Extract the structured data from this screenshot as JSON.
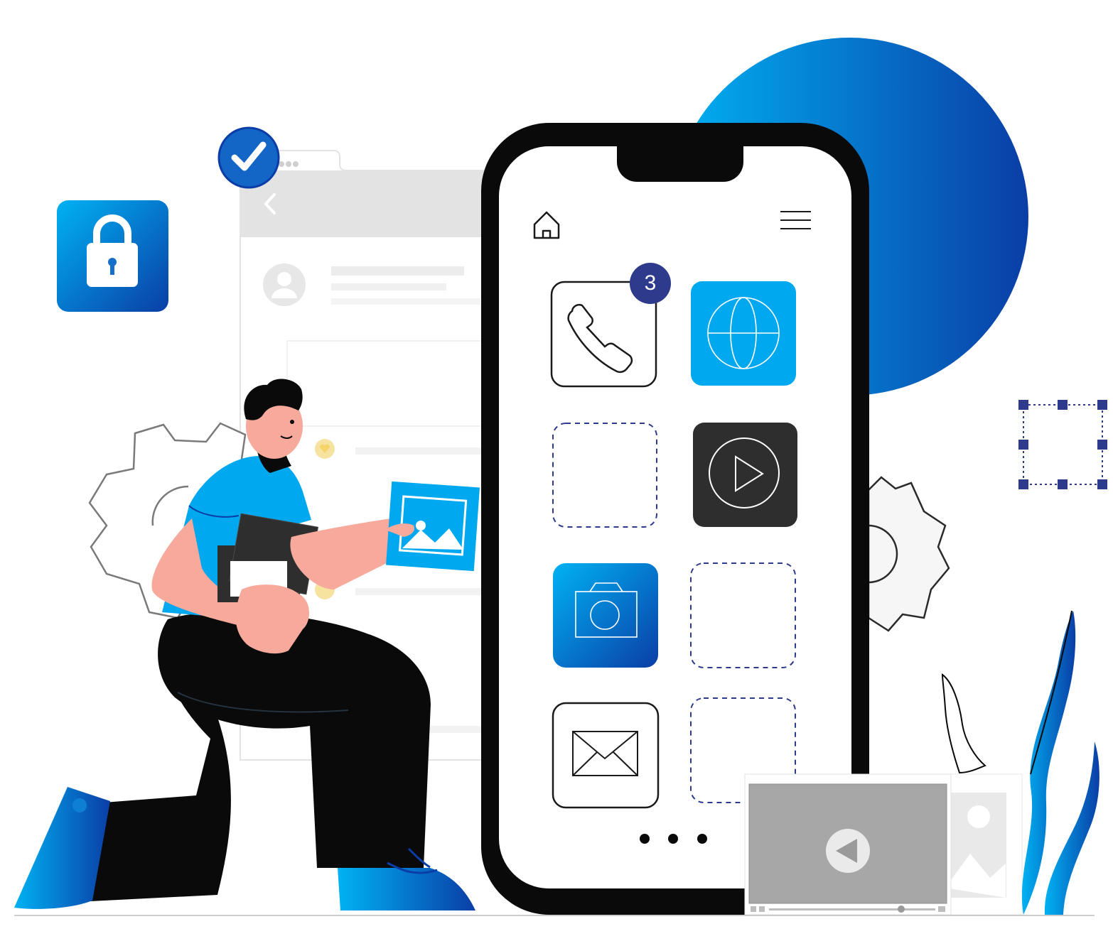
{
  "phone": {
    "notification_count": "3",
    "apps": [
      {
        "name": "phone",
        "icon": "phone-icon",
        "style": "outline"
      },
      {
        "name": "browser",
        "icon": "globe-icon",
        "style": "filled",
        "color": "#00a8ef"
      },
      {
        "name": "empty-slot-1",
        "icon": "",
        "style": "dashed"
      },
      {
        "name": "video",
        "icon": "play-icon",
        "style": "filled",
        "color": "#2e2e2e"
      },
      {
        "name": "camera",
        "icon": "camera-icon",
        "style": "gradient"
      },
      {
        "name": "empty-slot-2",
        "icon": "",
        "style": "dashed"
      },
      {
        "name": "mail",
        "icon": "envelope-icon",
        "style": "outline"
      },
      {
        "name": "empty-slot-3",
        "icon": "",
        "style": "dashed"
      }
    ],
    "top_bar_icons": [
      "home-icon",
      "hamburger-menu-icon"
    ],
    "page_indicator": "ellipsis-icon"
  },
  "decorations": {
    "lock_tile": "lock-icon",
    "verified_badge": "check-icon",
    "selection_box": "selection-handles",
    "gear_icons": [
      "gear-icon",
      "gear-icon"
    ]
  },
  "colors": {
    "primary_blue": "#00a8ef",
    "deep_blue": "#0a3fa8",
    "navy": "#2e3a8c",
    "skin": "#f7a99c",
    "ink": "#0a0a0a",
    "heart_yellow": "#f5d56a"
  }
}
